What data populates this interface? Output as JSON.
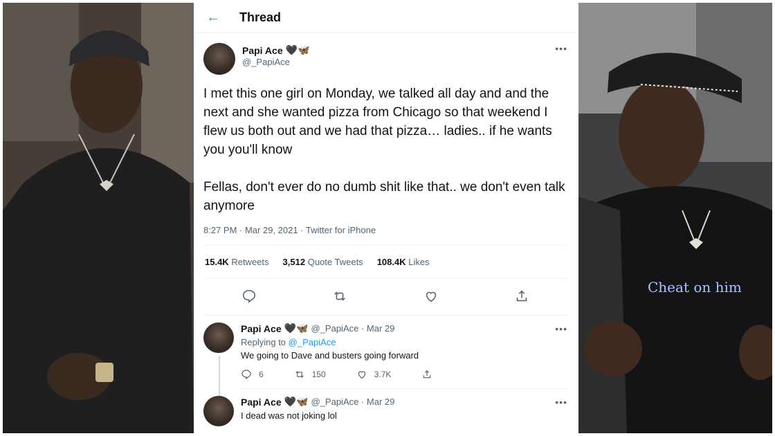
{
  "thread": {
    "title": "Thread",
    "main_tweet": {
      "author_name": "Papi Ace",
      "author_emojis": "🖤🦋",
      "handle": "@_PapiAce",
      "text": "I met this one girl on Monday, we talked all day and and the next and she wanted pizza from Chicago so that weekend I flew us both out and we had that pizza… ladies.. if he wants you you'll know\n\nFellas, don't ever do no dumb shit like that.. we don't even talk anymore",
      "time": "8:27 PM · Mar 29, 2021 ·",
      "source": "Twitter for iPhone",
      "stats": {
        "retweets_count": "15.4K",
        "retweets_label": "Retweets",
        "quotes_count": "3,512",
        "quotes_label": "Quote Tweets",
        "likes_count": "108.4K",
        "likes_label": "Likes"
      }
    },
    "replies": [
      {
        "author_name": "Papi Ace",
        "author_emojis": "🖤🦋",
        "meta": "@_PapiAce · Mar 29",
        "replying_label": "Replying to",
        "replying_mention": "@_PapiAce",
        "text": "We going to Dave and busters going forward",
        "reply_count": "6",
        "retweet_count": "150",
        "like_count": "3.7K"
      },
      {
        "author_name": "Papi Ace",
        "author_emojis": "🖤🦋",
        "meta": "@_PapiAce · Mar 29",
        "text": "I dead was not joking lol"
      }
    ]
  },
  "photos": {
    "right_shirt_text": "Cheat on him"
  },
  "icons": {
    "back": "back-arrow-icon",
    "more": "more-icon",
    "reply": "reply-icon",
    "retweet": "retweet-icon",
    "like": "heart-icon",
    "share": "share-icon"
  },
  "colors": {
    "accent": "#1d9bf0",
    "muted": "#536471",
    "text": "#0f1419"
  }
}
